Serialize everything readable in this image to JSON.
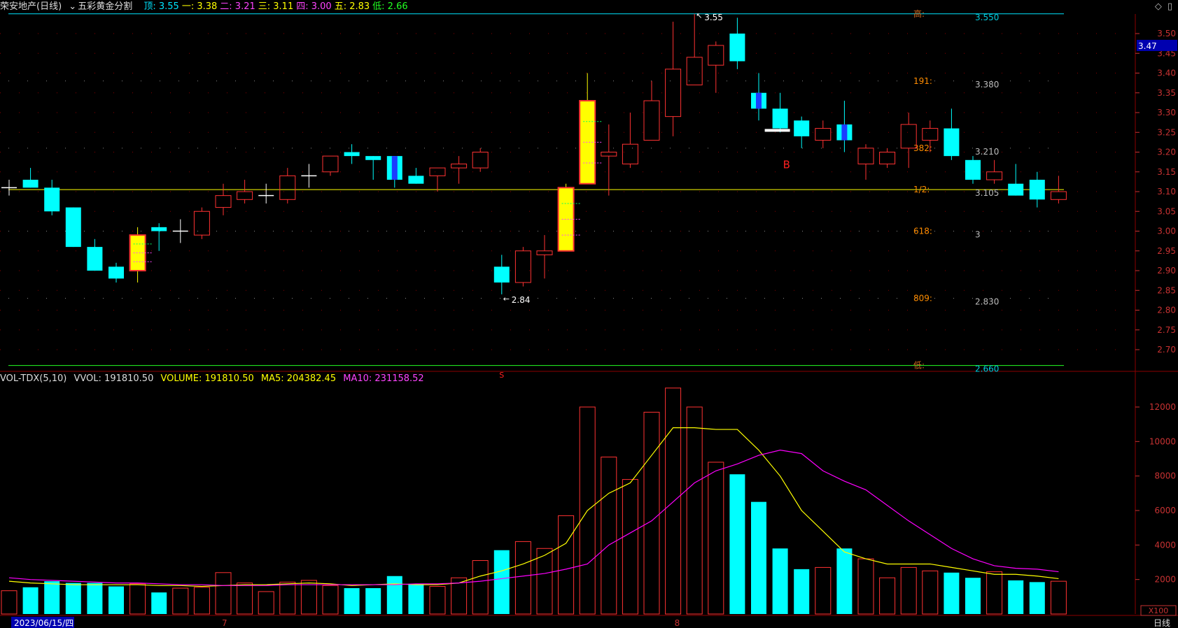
{
  "header": {
    "title": "荣安地产(日线)",
    "indicator_menu": "五彩黄金分割",
    "levels": [
      {
        "label": "顶:",
        "value": "3.55",
        "color": "#00e5ff"
      },
      {
        "label": "一:",
        "value": "3.38",
        "color": "#ffff00"
      },
      {
        "label": "二:",
        "value": "3.21",
        "color": "#ff44ff"
      },
      {
        "label": "三:",
        "value": "3.11",
        "color": "#ffff00"
      },
      {
        "label": "四:",
        "value": "3.00",
        "color": "#ff44ff"
      },
      {
        "label": "五:",
        "value": "2.83",
        "color": "#ffff00"
      },
      {
        "label": "低:",
        "value": "2.66",
        "color": "#22ff22"
      }
    ]
  },
  "volume_header": {
    "name": "VOL-TDX(5,10)",
    "vvol": "VVOL: 191810.50",
    "volume": "VOLUME: 191810.50",
    "ma5": "MA5: 204382.45",
    "ma10": "MA10: 231158.52"
  },
  "footer": {
    "date": "2023/06/15/四",
    "month_7": "7",
    "month_8": "8",
    "period": "日线",
    "vol_unit": "X100"
  },
  "price_marker": "3.47",
  "colors": {
    "up": "#ff3232",
    "down": "#00ffff",
    "ma5": "#ffff00",
    "ma10": "#ff00ff",
    "grid": "#8b0000",
    "axis_text": "#c83232"
  },
  "chart_data": [
    {
      "type": "candlestick",
      "title": "荣安地产(日线)",
      "ylim": [
        2.65,
        3.55
      ],
      "y_ticks": [
        "3.50",
        "3.45",
        "3.40",
        "3.35",
        "3.30",
        "3.25",
        "3.20",
        "3.15",
        "3.10",
        "3.05",
        "3.00",
        "2.95",
        "2.90",
        "2.85",
        "2.80",
        "2.75",
        "2.70"
      ],
      "candles": [
        {
          "o": 3.11,
          "h": 3.13,
          "l": 3.09,
          "c": 3.11,
          "style": "doji"
        },
        {
          "o": 3.13,
          "h": 3.16,
          "l": 3.11,
          "c": 3.11,
          "style": "down"
        },
        {
          "o": 3.11,
          "h": 3.13,
          "l": 3.04,
          "c": 3.05,
          "style": "down"
        },
        {
          "o": 3.06,
          "h": 3.06,
          "l": 2.96,
          "c": 2.96,
          "style": "down"
        },
        {
          "o": 2.96,
          "h": 2.98,
          "l": 2.9,
          "c": 2.9,
          "style": "down"
        },
        {
          "o": 2.91,
          "h": 2.92,
          "l": 2.87,
          "c": 2.88,
          "style": "down"
        },
        {
          "o": 2.9,
          "h": 3.01,
          "l": 2.87,
          "c": 2.99,
          "style": "gold"
        },
        {
          "o": 3.01,
          "h": 3.02,
          "l": 2.95,
          "c": 3.0,
          "style": "down"
        },
        {
          "o": 3.0,
          "h": 3.03,
          "l": 2.97,
          "c": 3.0,
          "style": "doji"
        },
        {
          "o": 2.99,
          "h": 3.06,
          "l": 2.98,
          "c": 3.05,
          "style": "up"
        },
        {
          "o": 3.06,
          "h": 3.12,
          "l": 3.04,
          "c": 3.09,
          "style": "up"
        },
        {
          "o": 3.08,
          "h": 3.13,
          "l": 3.07,
          "c": 3.1,
          "style": "up"
        },
        {
          "o": 3.09,
          "h": 3.12,
          "l": 3.07,
          "c": 3.09,
          "style": "doji"
        },
        {
          "o": 3.08,
          "h": 3.16,
          "l": 3.07,
          "c": 3.14,
          "style": "up"
        },
        {
          "o": 3.14,
          "h": 3.17,
          "l": 3.11,
          "c": 3.14,
          "style": "doji"
        },
        {
          "o": 3.15,
          "h": 3.19,
          "l": 3.14,
          "c": 3.19,
          "style": "up"
        },
        {
          "o": 3.2,
          "h": 3.22,
          "l": 3.17,
          "c": 3.19,
          "style": "down"
        },
        {
          "o": 3.19,
          "h": 3.19,
          "l": 3.13,
          "c": 3.18,
          "style": "down"
        },
        {
          "o": 3.19,
          "h": 3.19,
          "l": 3.11,
          "c": 3.13,
          "style": "blue"
        },
        {
          "o": 3.14,
          "h": 3.16,
          "l": 3.12,
          "c": 3.12,
          "style": "down"
        },
        {
          "o": 3.14,
          "h": 3.16,
          "l": 3.1,
          "c": 3.16,
          "style": "up"
        },
        {
          "o": 3.16,
          "h": 3.19,
          "l": 3.12,
          "c": 3.17,
          "style": "up"
        },
        {
          "o": 3.16,
          "h": 3.21,
          "l": 3.15,
          "c": 3.2,
          "style": "up"
        },
        {
          "o": 2.91,
          "h": 2.94,
          "l": 2.84,
          "c": 2.87,
          "style": "down"
        },
        {
          "o": 2.87,
          "h": 2.96,
          "l": 2.86,
          "c": 2.95,
          "style": "up"
        },
        {
          "o": 2.94,
          "h": 2.99,
          "l": 2.88,
          "c": 2.95,
          "style": "up"
        },
        {
          "o": 2.95,
          "h": 3.12,
          "l": 2.95,
          "c": 3.11,
          "style": "gold"
        },
        {
          "o": 3.12,
          "h": 3.4,
          "l": 3.12,
          "c": 3.33,
          "style": "gold"
        },
        {
          "o": 3.19,
          "h": 3.27,
          "l": 3.09,
          "c": 3.2,
          "style": "up"
        },
        {
          "o": 3.17,
          "h": 3.3,
          "l": 3.16,
          "c": 3.22,
          "style": "up"
        },
        {
          "o": 3.23,
          "h": 3.38,
          "l": 3.23,
          "c": 3.33,
          "style": "up"
        },
        {
          "o": 3.29,
          "h": 3.53,
          "l": 3.24,
          "c": 3.41,
          "style": "up"
        },
        {
          "o": 3.37,
          "h": 3.55,
          "l": 3.37,
          "c": 3.44,
          "style": "up"
        },
        {
          "o": 3.42,
          "h": 3.48,
          "l": 3.35,
          "c": 3.47,
          "style": "up"
        },
        {
          "o": 3.5,
          "h": 3.54,
          "l": 3.41,
          "c": 3.43,
          "style": "down"
        },
        {
          "o": 3.35,
          "h": 3.4,
          "l": 3.28,
          "c": 3.31,
          "style": "blue"
        },
        {
          "o": 3.31,
          "h": 3.35,
          "l": 3.25,
          "c": 3.26,
          "style": "down"
        },
        {
          "o": 3.28,
          "h": 3.29,
          "l": 3.21,
          "c": 3.24,
          "style": "down"
        },
        {
          "o": 3.23,
          "h": 3.28,
          "l": 3.21,
          "c": 3.26,
          "style": "up"
        },
        {
          "o": 3.27,
          "h": 3.33,
          "l": 3.2,
          "c": 3.23,
          "style": "blue"
        },
        {
          "o": 3.17,
          "h": 3.22,
          "l": 3.13,
          "c": 3.21,
          "style": "up"
        },
        {
          "o": 3.17,
          "h": 3.21,
          "l": 3.16,
          "c": 3.2,
          "style": "up"
        },
        {
          "o": 3.21,
          "h": 3.3,
          "l": 3.16,
          "c": 3.27,
          "style": "up"
        },
        {
          "o": 3.23,
          "h": 3.28,
          "l": 3.2,
          "c": 3.26,
          "style": "up"
        },
        {
          "o": 3.26,
          "h": 3.31,
          "l": 3.18,
          "c": 3.19,
          "style": "down"
        },
        {
          "o": 3.18,
          "h": 3.19,
          "l": 3.12,
          "c": 3.13,
          "style": "down"
        },
        {
          "o": 3.13,
          "h": 3.18,
          "l": 3.12,
          "c": 3.15,
          "style": "up"
        },
        {
          "o": 3.12,
          "h": 3.17,
          "l": 3.09,
          "c": 3.09,
          "style": "down"
        },
        {
          "o": 3.13,
          "h": 3.15,
          "l": 3.06,
          "c": 3.08,
          "style": "down"
        },
        {
          "o": 3.08,
          "h": 3.14,
          "l": 3.07,
          "c": 3.1,
          "style": "up"
        }
      ],
      "gap_index": 23,
      "golden_levels": [
        {
          "label": "高:",
          "value": "3.550",
          "price": 3.55,
          "color": "#00e5ff",
          "label_color": "#d2691e"
        },
        {
          "label": "191:",
          "value": "3.380",
          "price": 3.38,
          "color": "#888888",
          "label_color": "#ff8c00"
        },
        {
          "label": "382:",
          "value": "3.210",
          "price": 3.21,
          "color": "#888888",
          "label_color": "#ff8c00"
        },
        {
          "label": "1/2:",
          "value": "3.105",
          "price": 3.105,
          "color": "#ffff00",
          "label_color": "#ff8c00"
        },
        {
          "label": "618:",
          "value": "3",
          "price": 3.0,
          "color": "#888888",
          "label_color": "#ff8c00"
        },
        {
          "label": "809:",
          "value": "2.830",
          "price": 2.83,
          "color": "#888888",
          "label_color": "#ff8c00"
        },
        {
          "label": "低:",
          "value": "2.660",
          "price": 2.66,
          "color": "#22ff22",
          "label_color": "#d2691e"
        }
      ],
      "annotations": [
        {
          "text": "3.55",
          "index": 32,
          "price": 3.55
        },
        {
          "text": "2.84",
          "index": 23,
          "price": 2.84
        },
        {
          "text": "B",
          "index": 36,
          "price": 3.17
        },
        {
          "text": "S",
          "index": 23,
          "price": 2.64
        }
      ]
    },
    {
      "type": "bar",
      "title": "VOL-TDX(5,10)",
      "ylim": [
        0,
        13500
      ],
      "y_ticks": [
        "12000",
        "10000",
        "8000",
        "6000",
        "4000",
        "2000"
      ],
      "series": [
        {
          "name": "VOLUME",
          "values": [
            1350,
            1550,
            1900,
            1800,
            1800,
            1600,
            1750,
            1250,
            1500,
            1550,
            2400,
            1800,
            1300,
            1850,
            1950,
            1650,
            1500,
            1500,
            2200,
            1750,
            1600,
            2100,
            3100,
            3700,
            4200,
            3800,
            5700,
            12000,
            9100,
            7800,
            11700,
            13100,
            12000,
            8800,
            8100,
            6500,
            3800,
            2600,
            2700,
            3800,
            3200,
            2100,
            2700,
            2500,
            2400,
            2100,
            2450,
            1950,
            1850,
            1900
          ]
        },
        {
          "name": "MA5",
          "values": [
            1900,
            1800,
            1750,
            1700,
            1700,
            1700,
            1700,
            1650,
            1650,
            1600,
            1650,
            1700,
            1700,
            1750,
            1800,
            1750,
            1650,
            1700,
            1750,
            1700,
            1700,
            1800,
            2200,
            2500,
            2900,
            3400,
            4100,
            6000,
            7000,
            7600,
            9200,
            10800,
            10800,
            10700,
            10700,
            9500,
            8000,
            6000,
            4800,
            3600,
            3200,
            2900,
            2900,
            2900,
            2700,
            2500,
            2300,
            2300,
            2200,
            2050
          ]
        },
        {
          "name": "MA10",
          "values": [
            2100,
            2000,
            1950,
            1900,
            1850,
            1800,
            1800,
            1750,
            1700,
            1700,
            1650,
            1650,
            1650,
            1700,
            1700,
            1700,
            1700,
            1700,
            1700,
            1750,
            1750,
            1800,
            1900,
            2050,
            2200,
            2350,
            2600,
            2900,
            4000,
            4700,
            5400,
            6500,
            7600,
            8300,
            8700,
            9200,
            9500,
            9300,
            8300,
            7700,
            7200,
            6300,
            5400,
            4600,
            3800,
            3200,
            2800,
            2650,
            2600,
            2450
          ]
        }
      ]
    }
  ]
}
